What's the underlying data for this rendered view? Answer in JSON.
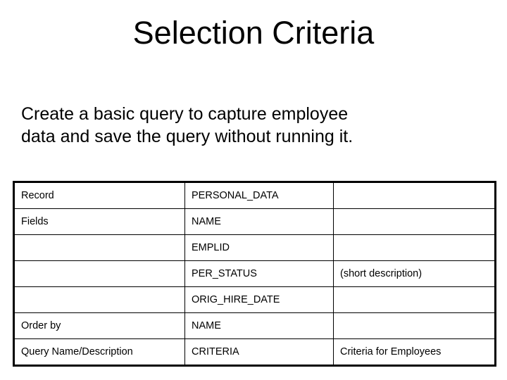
{
  "slide": {
    "title": "Selection Criteria",
    "body_lines": [
      "Create a basic query to capture employee",
      "data and save the query without running it."
    ],
    "colors": {
      "background": "#ffffff",
      "text": "#000000",
      "table_border": "#000000"
    }
  },
  "table": {
    "columns": 3,
    "rows": [
      {
        "label": "Record",
        "value": "PERSONAL_DATA",
        "note": ""
      },
      {
        "label": "Fields",
        "value": "NAME",
        "note": ""
      },
      {
        "label": "",
        "value": "EMPLID",
        "note": ""
      },
      {
        "label": "",
        "value": "PER_STATUS",
        "note": "(short description)"
      },
      {
        "label": "",
        "value": "ORIG_HIRE_DATE",
        "note": ""
      },
      {
        "label": "Order by",
        "value": "NAME",
        "note": ""
      },
      {
        "label": "Query Name/Description",
        "value": "CRITERIA",
        "note": "Criteria for Employees"
      }
    ]
  }
}
